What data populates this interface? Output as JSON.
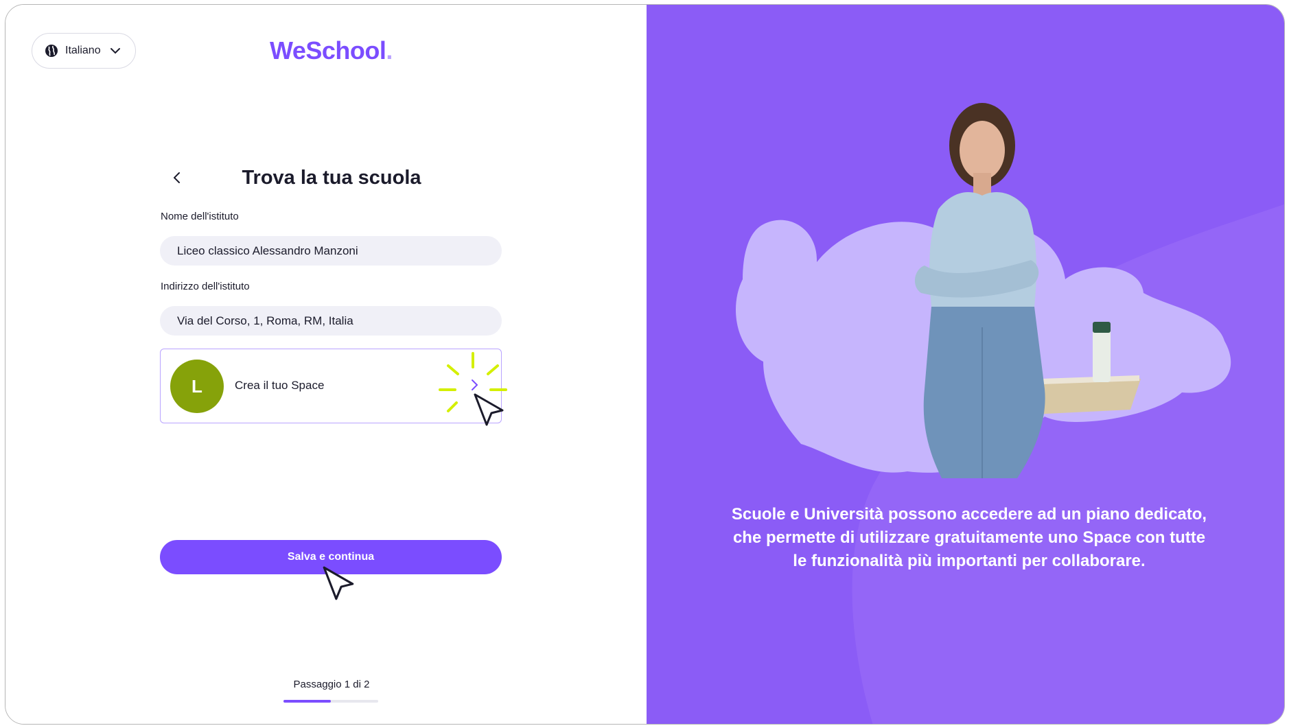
{
  "header": {
    "language": {
      "label": "Italiano",
      "icon": "globe-icon"
    },
    "logo": {
      "text": "WeSchool",
      "dot": "."
    }
  },
  "form": {
    "title": "Trova la tua scuola",
    "fields": [
      {
        "label": "Nome dell'istituto",
        "value": "Liceo classico Alessandro Manzoni"
      },
      {
        "label": "Indirizzo dell'istituto",
        "value": "Via del Corso, 1, Roma, RM, Italia"
      }
    ],
    "space_card": {
      "avatar_letter": "L",
      "label": "Crea il tuo Space"
    },
    "submit_label": "Salva e continua",
    "step_text": "Passaggio 1 di 2",
    "progress_fraction": 0.5
  },
  "promo": {
    "text": "Scuole e Università possono accedere ad un piano dedicato, che permette di utilizzare gratuitamente uno Space con tutte le funzionalità più importanti per collaborare."
  },
  "colors": {
    "accent": "#7b4dff",
    "panel": "#8b5cf6",
    "avatar": "#86a20a",
    "spark": "#d4ef00"
  }
}
